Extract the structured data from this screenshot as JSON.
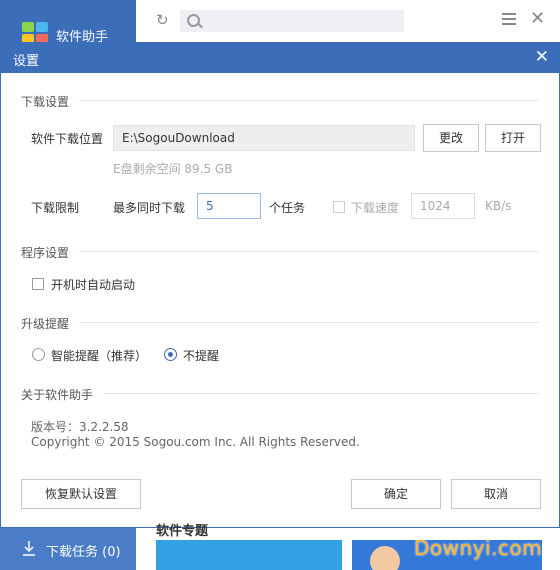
{
  "app": {
    "title": "软件助手",
    "download_tasks_label": "下载任务 (0)",
    "bg_heading": "软件专题",
    "watermark": "Downyi.com"
  },
  "dialog": {
    "title": "设置",
    "close_glyph": "✕",
    "download_section": {
      "title": "下载设置",
      "location_label": "软件下载位置",
      "location_value": "E:\\SogouDownload",
      "change_button": "更改",
      "open_button": "打开",
      "free_space": "E盘剩余空间 89.5 GB",
      "limit_label": "下载限制",
      "max_simul_label": "最多同时下载",
      "max_simul_value": "5",
      "tasks_unit": "个任务",
      "speed_label": "下载速度",
      "speed_value": "1024",
      "speed_unit": "KB/s"
    },
    "program_section": {
      "title": "程序设置",
      "autostart_label": "开机时自动启动"
    },
    "upgrade_section": {
      "title": "升级提醒",
      "smart_label": "智能提醒（推荐）",
      "none_label": "不提醒",
      "selected": "不提醒"
    },
    "about_section": {
      "title": "关于软件助手",
      "version": "版本号：3.2.2.58",
      "copyright": "Copyright © 2015 Sogou.com Inc. All Rights Reserved."
    },
    "footer": {
      "restore_button": "恢复默认设置",
      "ok_button": "确定",
      "cancel_button": "取消"
    }
  },
  "colors": {
    "accent": "#3c6db9",
    "watermark": "#ffb12b"
  }
}
